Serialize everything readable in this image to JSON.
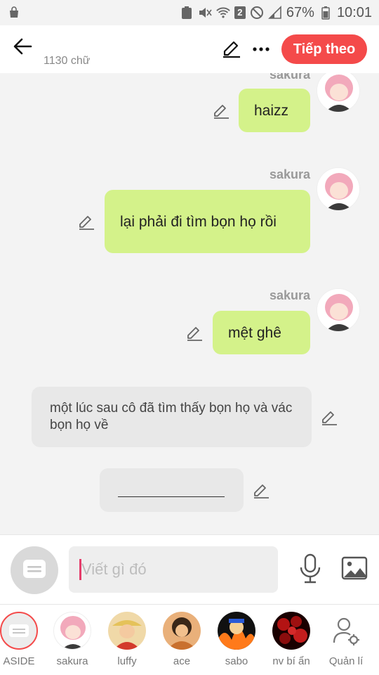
{
  "status_bar": {
    "battery_percent": "67%",
    "time": "10:01",
    "sim_badge": "2"
  },
  "header": {
    "char_count": "1130 chữ",
    "next_label": "Tiếp theo"
  },
  "messages": [
    {
      "type": "character",
      "name": "sakura",
      "text": "haizz"
    },
    {
      "type": "character",
      "name": "sakura",
      "text": "lại phải đi tìm bọn họ rồi"
    },
    {
      "type": "character",
      "name": "sakura",
      "text": "mệt ghê"
    },
    {
      "type": "narration",
      "text": "một lúc sau cô đã tìm thấy bọn họ và vác bọn họ về"
    },
    {
      "type": "narration",
      "text": ""
    }
  ],
  "composer": {
    "placeholder": "Viết gì đó"
  },
  "characters": [
    {
      "label": "ASIDE",
      "icon": "narration-icon"
    },
    {
      "label": "sakura",
      "color": "#f3a3b5"
    },
    {
      "label": "luffy",
      "color": "#d33a2c"
    },
    {
      "label": "ace",
      "color": "#c9702e"
    },
    {
      "label": "sabo",
      "color": "#2a5bd7"
    },
    {
      "label": "nv bí ẩn",
      "color": "#9e1010"
    },
    {
      "label": "Quản lí",
      "icon": "manage-characters-icon"
    }
  ],
  "colors": {
    "accent": "#f44a4a",
    "bubble_character": "#d4f28a",
    "bubble_narration": "#e8e8e8"
  }
}
